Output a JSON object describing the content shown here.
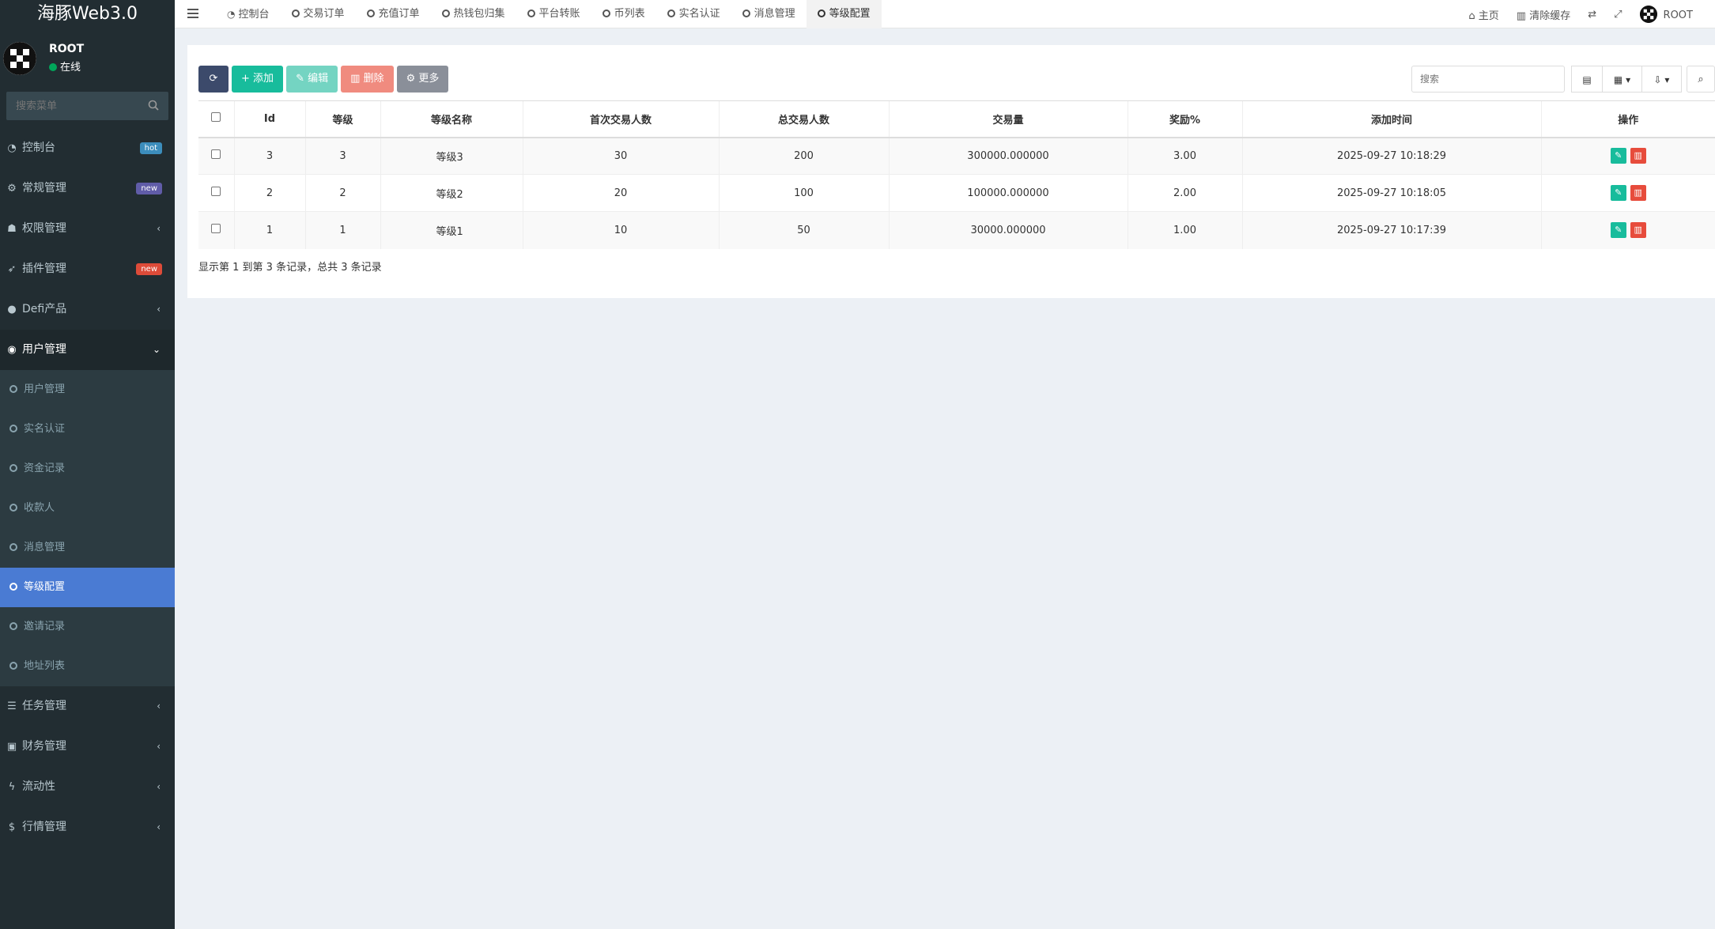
{
  "app": {
    "logo": "海豚Web3.0",
    "user_name": "ROOT",
    "user_status": "在线",
    "search_placeholder": "搜索菜单"
  },
  "sidebar": {
    "items": [
      {
        "label": "控制台",
        "icon": "dashboard-icon",
        "badge": "hot"
      },
      {
        "label": "常规管理",
        "icon": "cogs-icon",
        "badge": "new"
      },
      {
        "label": "权限管理",
        "icon": "users-icon",
        "chevron": "‹"
      },
      {
        "label": "插件管理",
        "icon": "rocket-icon",
        "badge": "new"
      },
      {
        "label": "Defi产品",
        "icon": "product-icon",
        "chevron": "‹"
      },
      {
        "label": "用户管理",
        "icon": "user-circle-icon",
        "chevron": "⌄"
      }
    ],
    "submenu": [
      {
        "label": "用户管理"
      },
      {
        "label": "实名认证"
      },
      {
        "label": "资金记录"
      },
      {
        "label": "收款人"
      },
      {
        "label": "消息管理"
      },
      {
        "label": "等级配置",
        "active": true
      },
      {
        "label": "邀请记录"
      },
      {
        "label": "地址列表"
      }
    ],
    "bottom_items": [
      {
        "label": "任务管理",
        "icon": "list-icon",
        "chevron": "‹"
      },
      {
        "label": "财务管理",
        "icon": "money-icon",
        "chevron": "‹"
      },
      {
        "label": "流动性",
        "icon": "bolt-icon",
        "chevron": "‹"
      },
      {
        "label": "行情管理",
        "icon": "dollar-icon",
        "chevron": "‹"
      }
    ]
  },
  "topnav": {
    "tabs": [
      "控制台",
      "交易订单",
      "充值订单",
      "热钱包归集",
      "平台转账",
      "币列表",
      "实名认证",
      "消息管理",
      "等级配置"
    ],
    "right": {
      "home": "主页",
      "clear_cache": "清除缓存",
      "user": "ROOT"
    }
  },
  "toolbar": {
    "add": "添加",
    "edit": "编辑",
    "delete": "删除",
    "more": "更多",
    "search_placeholder": "搜索"
  },
  "table": {
    "headers": [
      "Id",
      "等级",
      "等级名称",
      "首次交易人数",
      "总交易人数",
      "交易量",
      "奖励%",
      "添加时间",
      "操作"
    ],
    "rows": [
      {
        "id": "3",
        "level": "3",
        "name": "等级3",
        "first": "30",
        "total": "200",
        "volume": "300000.000000",
        "reward": "3.00",
        "time": "2025-09-27 10:18:29"
      },
      {
        "id": "2",
        "level": "2",
        "name": "等级2",
        "first": "20",
        "total": "100",
        "volume": "100000.000000",
        "reward": "2.00",
        "time": "2025-09-27 10:18:05"
      },
      {
        "id": "1",
        "level": "1",
        "name": "等级1",
        "first": "10",
        "total": "50",
        "volume": "30000.000000",
        "reward": "1.00",
        "time": "2025-09-27 10:17:39"
      }
    ],
    "footer": "显示第 1 到第 3 条记录，总共 3 条记录"
  }
}
